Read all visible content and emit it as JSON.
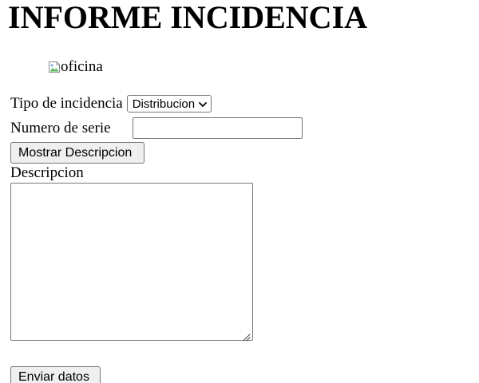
{
  "page": {
    "title": "INFORME INCIDENCIA"
  },
  "image": {
    "alt": "oficina",
    "icon": "broken-image-icon"
  },
  "form": {
    "tipo_label": "Tipo de incidencia",
    "tipo_selected": "Distribucion",
    "serie_label": "Numero de serie",
    "serie_value": "",
    "mostrar_button": "Mostrar Descripcion",
    "descripcion_label": "Descripcion",
    "descripcion_value": "",
    "enviar_button": "Enviar datos"
  },
  "colors": {
    "border": "#767676",
    "button_bg": "#efefef"
  }
}
